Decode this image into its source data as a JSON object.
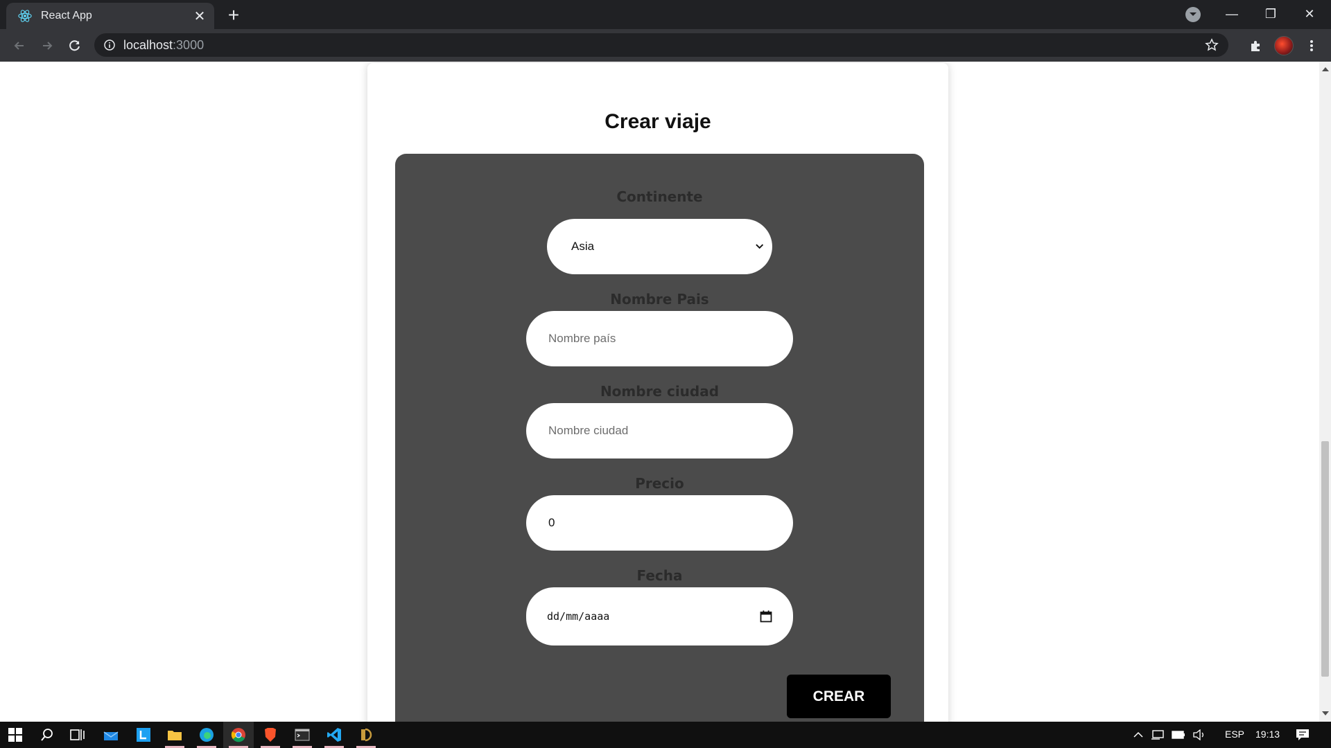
{
  "browser": {
    "tab_title": "React App",
    "url_host": "localhost",
    "url_port": ":3000"
  },
  "page": {
    "title": "Crear viaje",
    "form": {
      "continent": {
        "label": "Continente",
        "selected": "Asia"
      },
      "country": {
        "label": "Nombre Pais",
        "placeholder": "Nombre país",
        "value": ""
      },
      "city": {
        "label": "Nombre ciudad",
        "placeholder": "Nombre ciudad",
        "value": ""
      },
      "price": {
        "label": "Precio",
        "value": "0"
      },
      "date": {
        "label": "Fecha",
        "placeholder": "dd/mm/aaaa"
      },
      "submit_label": "CREAR"
    }
  },
  "taskbar": {
    "apps": [
      "start-icon",
      "search-icon",
      "task-view-icon",
      "mail-icon",
      "l-app-icon",
      "file-explorer-icon",
      "edge-icon",
      "chrome-icon",
      "brave-icon",
      "terminal-icon",
      "vscode-icon",
      "app-icon"
    ],
    "language": "ESP",
    "time": "19:13"
  },
  "colors": {
    "form_panel": "#4b4b4b",
    "button": "#000000",
    "browser_dark": "#202124"
  }
}
